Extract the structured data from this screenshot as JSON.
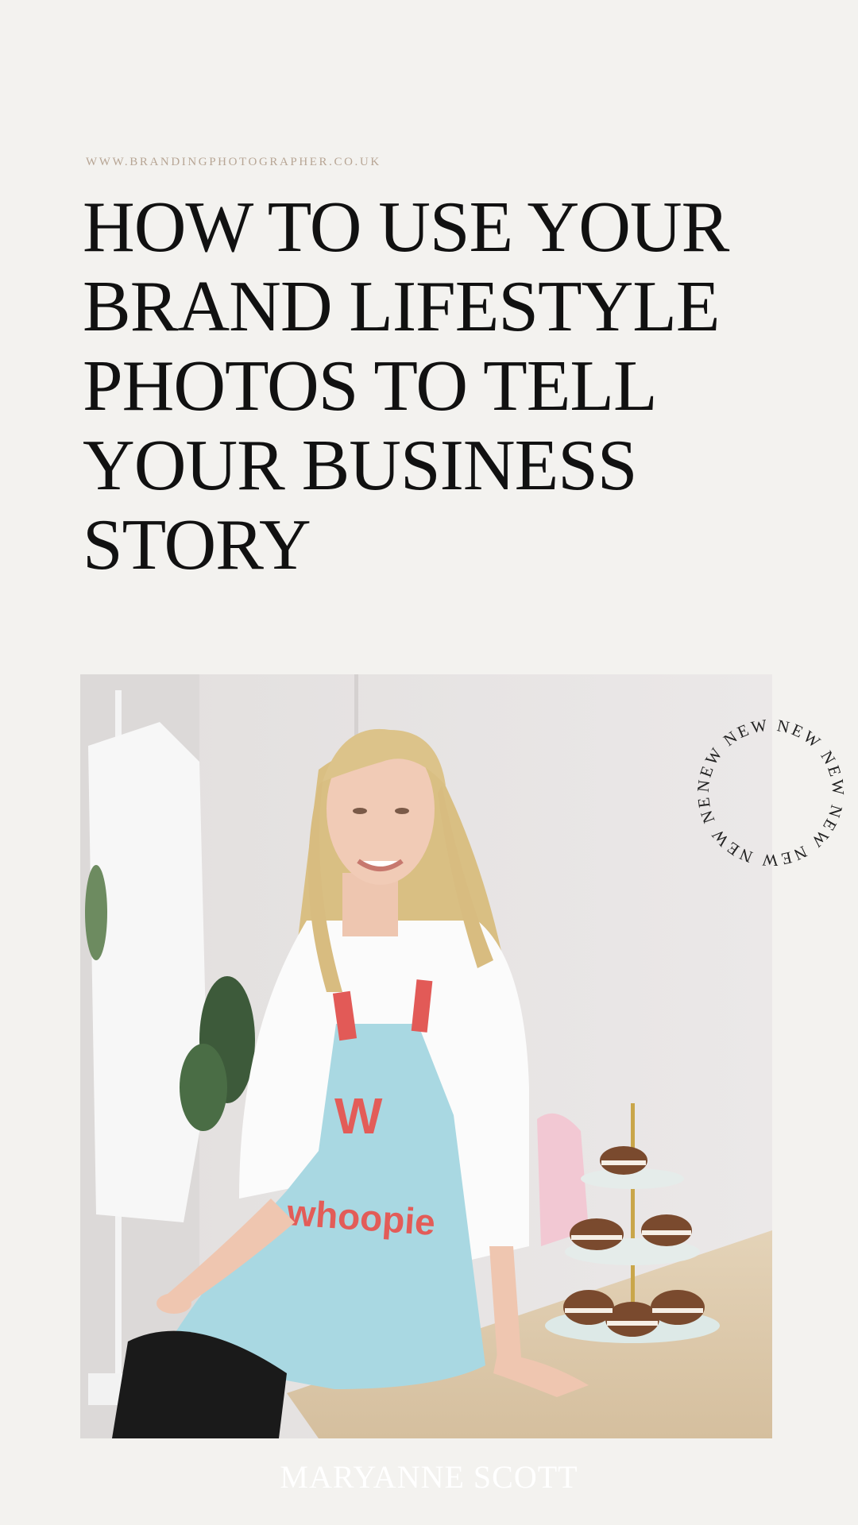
{
  "site_url": "WWW.BRANDINGPHOTOGRAPHER.CO.UK",
  "headline_lines": [
    "HOW TO USE YOUR",
    "BRAND LIFESTYLE",
    "PHOTOS TO TELL",
    "YOUR BUSINESS",
    "STORY"
  ],
  "badge_text": "NEW NEW NEW NEW NEW NEW NEW NEW ",
  "apron_logo": "whoopie",
  "author": "MARYANNE SCOTT"
}
